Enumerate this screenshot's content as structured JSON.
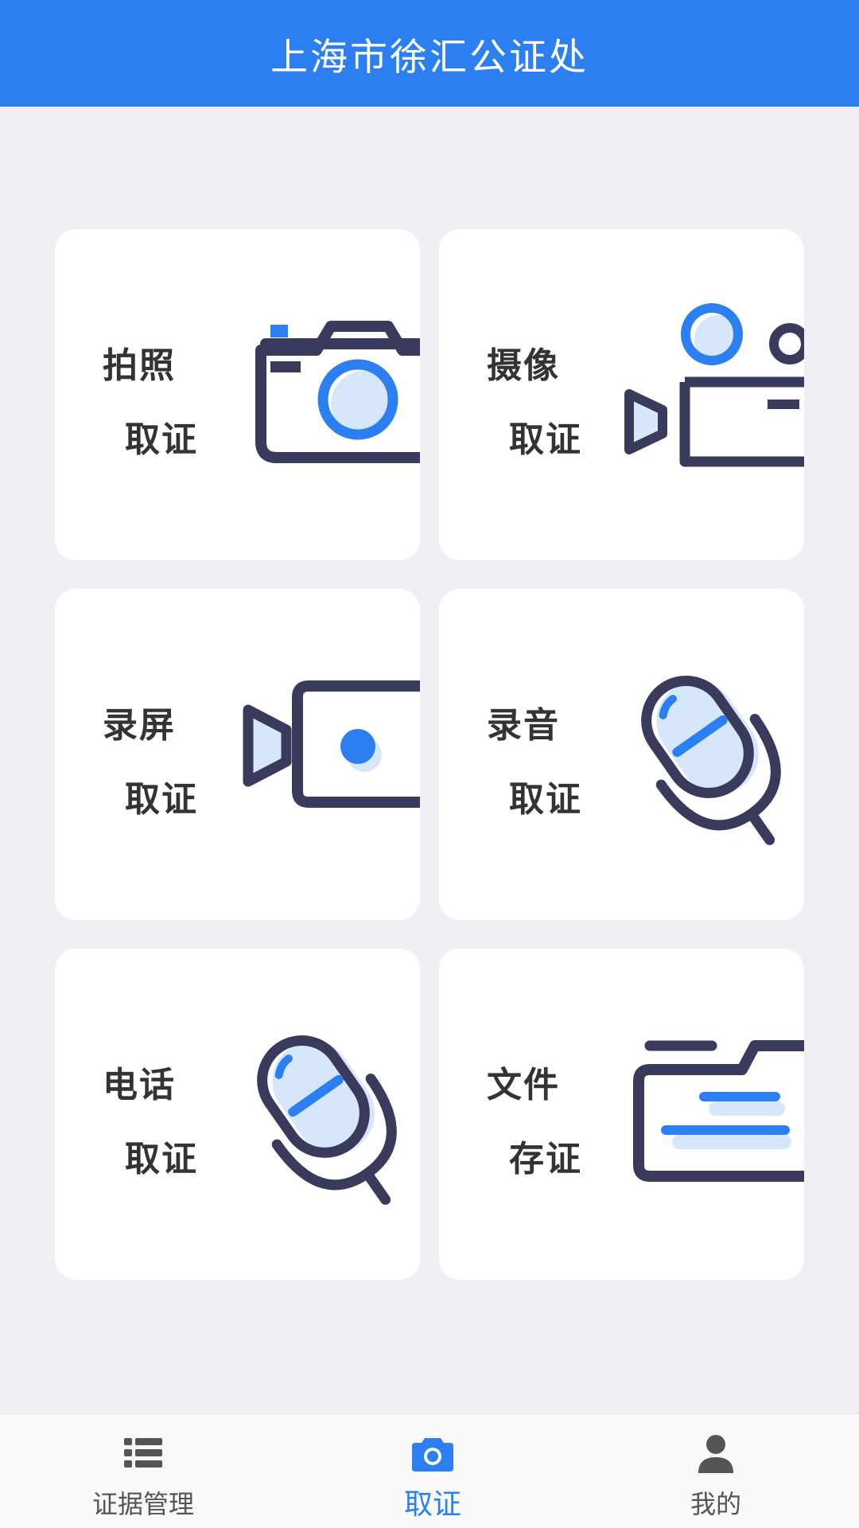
{
  "header": {
    "title": "上海市徐汇公证处"
  },
  "cards": [
    {
      "line1": "拍照",
      "line2": "取证",
      "icon": "photo-camera-icon"
    },
    {
      "line1": "摄像",
      "line2": "取证",
      "icon": "video-camera-icon"
    },
    {
      "line1": "录屏",
      "line2": "取证",
      "icon": "screen-record-icon"
    },
    {
      "line1": "录音",
      "line2": "取证",
      "icon": "microphone-icon"
    },
    {
      "line1": "电话",
      "line2": "取证",
      "icon": "phone-microphone-icon"
    },
    {
      "line1": "文件",
      "line2": "存证",
      "icon": "folder-icon"
    }
  ],
  "tabbar": {
    "items": [
      {
        "label": "证据管理",
        "icon": "list-icon"
      },
      {
        "label": "取证",
        "icon": "camera-icon",
        "active": true
      },
      {
        "label": "我的",
        "icon": "user-icon"
      }
    ]
  },
  "colors": {
    "accent": "#2b7ff0",
    "icon_dark": "#3a3a5c",
    "icon_light": "#d6e6fb",
    "background": "#efeff4"
  }
}
